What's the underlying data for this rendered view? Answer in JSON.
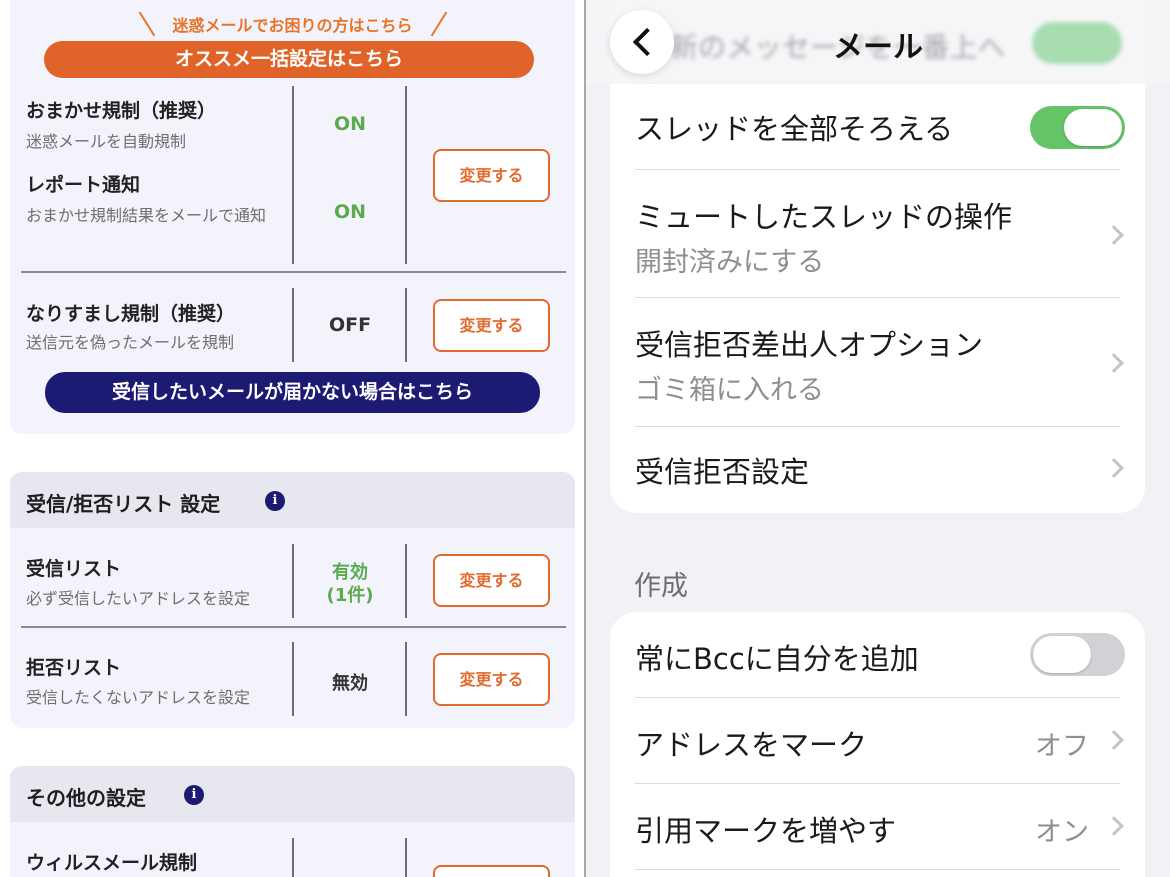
{
  "left": {
    "promo_text": "迷惑メールでお困りの方はこちら",
    "bulk_setting_button": "オススメ一括設定はこちら",
    "omakase": {
      "label": "おまかせ規制（推奨）",
      "desc": "迷惑メールを自動規制",
      "status": "ON"
    },
    "report": {
      "label": "レポート通知",
      "desc": "おまかせ規制結果をメールで通知",
      "status": "ON"
    },
    "narisumashi": {
      "label": "なりすまし規制（推奨）",
      "desc": "送信元を偽ったメールを規制",
      "status": "OFF"
    },
    "change_label": "変更する",
    "not_received_button": "受信したいメールが届かない場合はこちら",
    "list_section": {
      "title": "受信/拒否リスト 設定",
      "info_icon": "i",
      "receive": {
        "label": "受信リスト",
        "desc": "必ず受信したいアドレスを設定",
        "status_line1": "有効",
        "status_line2": "(1件)"
      },
      "reject": {
        "label": "拒否リスト",
        "desc": "受信したくないアドレスを設定",
        "status": "無効"
      }
    },
    "other_section": {
      "title": "その他の設定",
      "info_icon": "i",
      "virus": {
        "label": "ウィルスメール規制"
      }
    }
  },
  "right": {
    "nav": {
      "title": "メール",
      "ghost_text": "新のメッセージを一番上へ"
    },
    "rows": {
      "thread_all": {
        "label": "スレッドを全部そろえる",
        "toggle": "on"
      },
      "muted_thread": {
        "label": "ミュートしたスレッドの操作",
        "value": "開封済みにする"
      },
      "blocked_sender": {
        "label": "受信拒否差出人オプション",
        "value": "ゴミ箱に入れる"
      },
      "blocked_settings": {
        "label": "受信拒否設定"
      }
    },
    "compose_section": {
      "title": "作成",
      "always_bcc": {
        "label": "常にBccに自分を追加",
        "toggle": "off"
      },
      "mark_address": {
        "label": "アドレスをマーク",
        "value": "オフ"
      },
      "quote_level": {
        "label": "引用マークを増やす",
        "value": "オン"
      }
    }
  },
  "colors": {
    "orange": "#e0642a",
    "navy": "#1c1a73",
    "green_status": "#5bab4e",
    "ios_green": "#65c466"
  }
}
